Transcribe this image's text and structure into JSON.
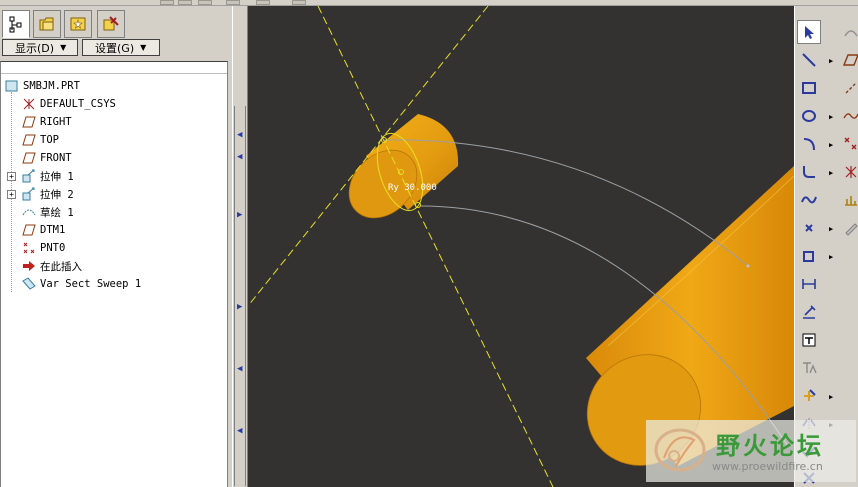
{
  "panel": {
    "show_menu": "显示(D)",
    "settings_menu": "设置(G)"
  },
  "model_tree": {
    "root": "SMBJM.PRT",
    "items": [
      {
        "label": "DEFAULT_CSYS",
        "icon": "csys-icon"
      },
      {
        "label": "RIGHT",
        "icon": "datum-plane-icon"
      },
      {
        "label": "TOP",
        "icon": "datum-plane-icon"
      },
      {
        "label": "FRONT",
        "icon": "datum-plane-icon"
      },
      {
        "label": "拉伸 1",
        "icon": "extrude-icon"
      },
      {
        "label": "拉伸 2",
        "icon": "extrude-icon"
      },
      {
        "label": "草绘 1",
        "icon": "sketch-icon"
      },
      {
        "label": "DTM1",
        "icon": "datum-plane-icon"
      },
      {
        "label": "PNT0",
        "icon": "datum-point-icon"
      },
      {
        "label": "在此插入",
        "icon": "insert-here-arrow-icon"
      },
      {
        "label": "Var Sect Sweep 1",
        "icon": "var-sect-sweep-icon"
      }
    ]
  },
  "viewport": {
    "dimension_label": "Ry 30.000",
    "colors": {
      "background": "#333230",
      "cylinder": "#E8A010",
      "datum": "#E8E020"
    }
  },
  "watermark": {
    "title": "野火论坛",
    "url": "www.proewildfire.cn"
  }
}
